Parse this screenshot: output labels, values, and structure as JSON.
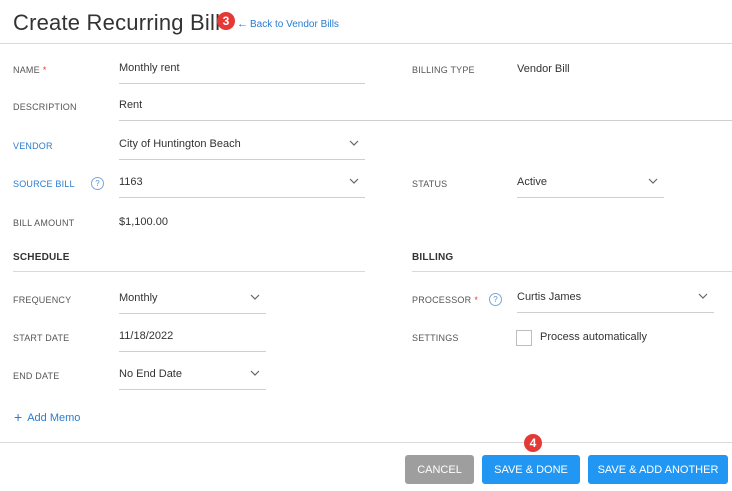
{
  "header": {
    "title": "Create Recurring Bill",
    "back_link": "Back to Vendor Bills",
    "back_arrow": "←"
  },
  "badges": {
    "first": "3",
    "second": "4"
  },
  "form": {
    "name": {
      "label": "NAME",
      "required_mark": "*",
      "value": "Monthly rent"
    },
    "billing_type": {
      "label": "BILLING TYPE",
      "value": "Vendor Bill"
    },
    "description": {
      "label": "DESCRIPTION",
      "value": "Rent"
    },
    "vendor": {
      "label": "VENDOR",
      "value": "City of Huntington Beach"
    },
    "source_bill": {
      "label": "SOURCE BILL",
      "value": "1163"
    },
    "status": {
      "label": "STATUS",
      "value": "Active"
    },
    "bill_amount": {
      "label": "BILL AMOUNT",
      "value": "$1,100.00"
    }
  },
  "schedule": {
    "heading": "SCHEDULE",
    "frequency": {
      "label": "FREQUENCY",
      "value": "Monthly"
    },
    "start_date": {
      "label": "START DATE",
      "value": "11/18/2022"
    },
    "end_date": {
      "label": "END DATE",
      "value": "No End Date"
    }
  },
  "billing": {
    "heading": "BILLING",
    "processor": {
      "label": "PROCESSOR",
      "required_mark": "*",
      "value": "Curtis James"
    },
    "settings": {
      "label": "SETTINGS",
      "checkbox_label": "Process automatically",
      "checked": false
    }
  },
  "help_glyph": "?",
  "add_memo": {
    "plus": "+",
    "label": "Add Memo"
  },
  "buttons": {
    "cancel": "CANCEL",
    "save_done": "SAVE & DONE",
    "save_add_another": "SAVE & ADD ANOTHER"
  },
  "colors": {
    "accent": "#2196f3",
    "link": "#2a7ccf",
    "cancel": "#9e9e9e",
    "badge": "#e53935",
    "required": "#e53935"
  }
}
